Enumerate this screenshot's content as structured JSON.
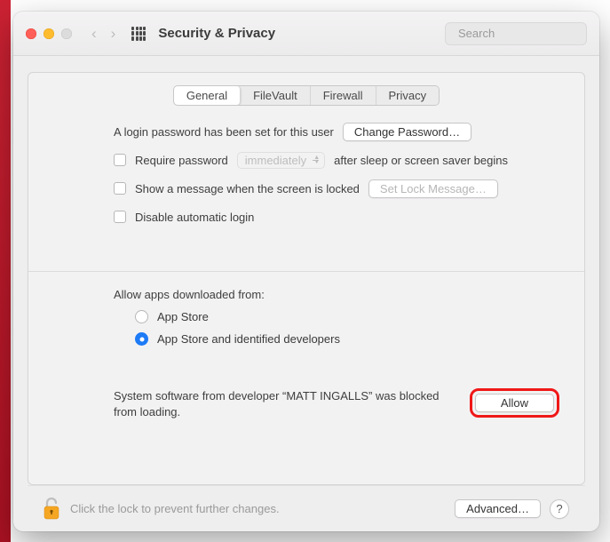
{
  "window": {
    "title": "Security & Privacy"
  },
  "search": {
    "placeholder": "Search"
  },
  "tabs": {
    "general": "General",
    "filevault": "FileVault",
    "firewall": "Firewall",
    "privacy": "Privacy"
  },
  "general": {
    "login_pwd_set": "A login password has been set for this user",
    "change_password": "Change Password…",
    "require_password": "Require password",
    "require_password_delay": "immediately",
    "require_password_suffix": "after sleep or screen saver begins",
    "show_message": "Show a message when the screen is locked",
    "set_lock_message": "Set Lock Message…",
    "disable_auto_login": "Disable automatic login"
  },
  "download": {
    "heading": "Allow apps downloaded from:",
    "app_store": "App Store",
    "identified": "App Store and identified developers"
  },
  "blocked": {
    "text": "System software from developer “MATT INGALLS” was blocked from loading.",
    "allow": "Allow"
  },
  "footer": {
    "lock_text": "Click the lock to prevent further changes.",
    "advanced": "Advanced…",
    "help": "?"
  }
}
